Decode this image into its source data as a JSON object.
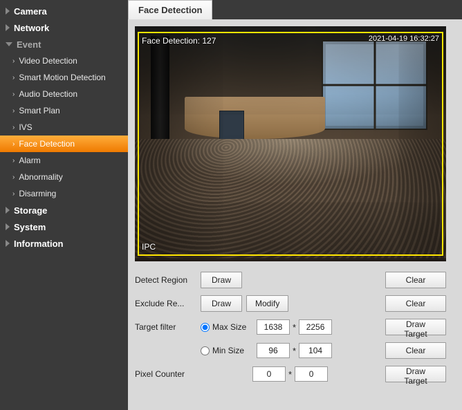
{
  "sidebar": {
    "top": [
      {
        "label": "Camera",
        "expanded": false
      },
      {
        "label": "Network",
        "expanded": false
      },
      {
        "label": "Event",
        "expanded": true
      },
      {
        "label": "Storage",
        "expanded": false
      },
      {
        "label": "System",
        "expanded": false
      },
      {
        "label": "Information",
        "expanded": false
      }
    ],
    "eventItems": [
      {
        "label": "Video Detection",
        "active": false
      },
      {
        "label": "Smart Motion Detection",
        "active": false
      },
      {
        "label": "Audio Detection",
        "active": false
      },
      {
        "label": "Smart Plan",
        "active": false
      },
      {
        "label": "IVS",
        "active": false
      },
      {
        "label": "Face Detection",
        "active": true
      },
      {
        "label": "Alarm",
        "active": false
      },
      {
        "label": "Abnormality",
        "active": false
      },
      {
        "label": "Disarming",
        "active": false
      }
    ]
  },
  "tab": {
    "label": "Face Detection"
  },
  "video": {
    "overlayTopLeft": "Face Detection: 127",
    "overlayTopRight": "2021-04-19 16:32:27",
    "overlayBottomLeft": "IPC"
  },
  "controls": {
    "detectRegion": {
      "label": "Detect Region",
      "draw": "Draw",
      "clear": "Clear"
    },
    "excludeRegion": {
      "label": "Exclude Re...",
      "draw": "Draw",
      "modify": "Modify",
      "clear": "Clear"
    },
    "targetFilter": {
      "label": "Target filter",
      "maxSize": {
        "label": "Max Size",
        "w": "1638",
        "h": "2256"
      },
      "minSize": {
        "label": "Min Size",
        "w": "96",
        "h": "104"
      },
      "drawTarget": "Draw Target",
      "clear": "Clear",
      "sep": "*"
    },
    "pixelCounter": {
      "label": "Pixel Counter",
      "w": "0",
      "h": "0",
      "drawTarget": "Draw Target",
      "sep": "*"
    }
  }
}
